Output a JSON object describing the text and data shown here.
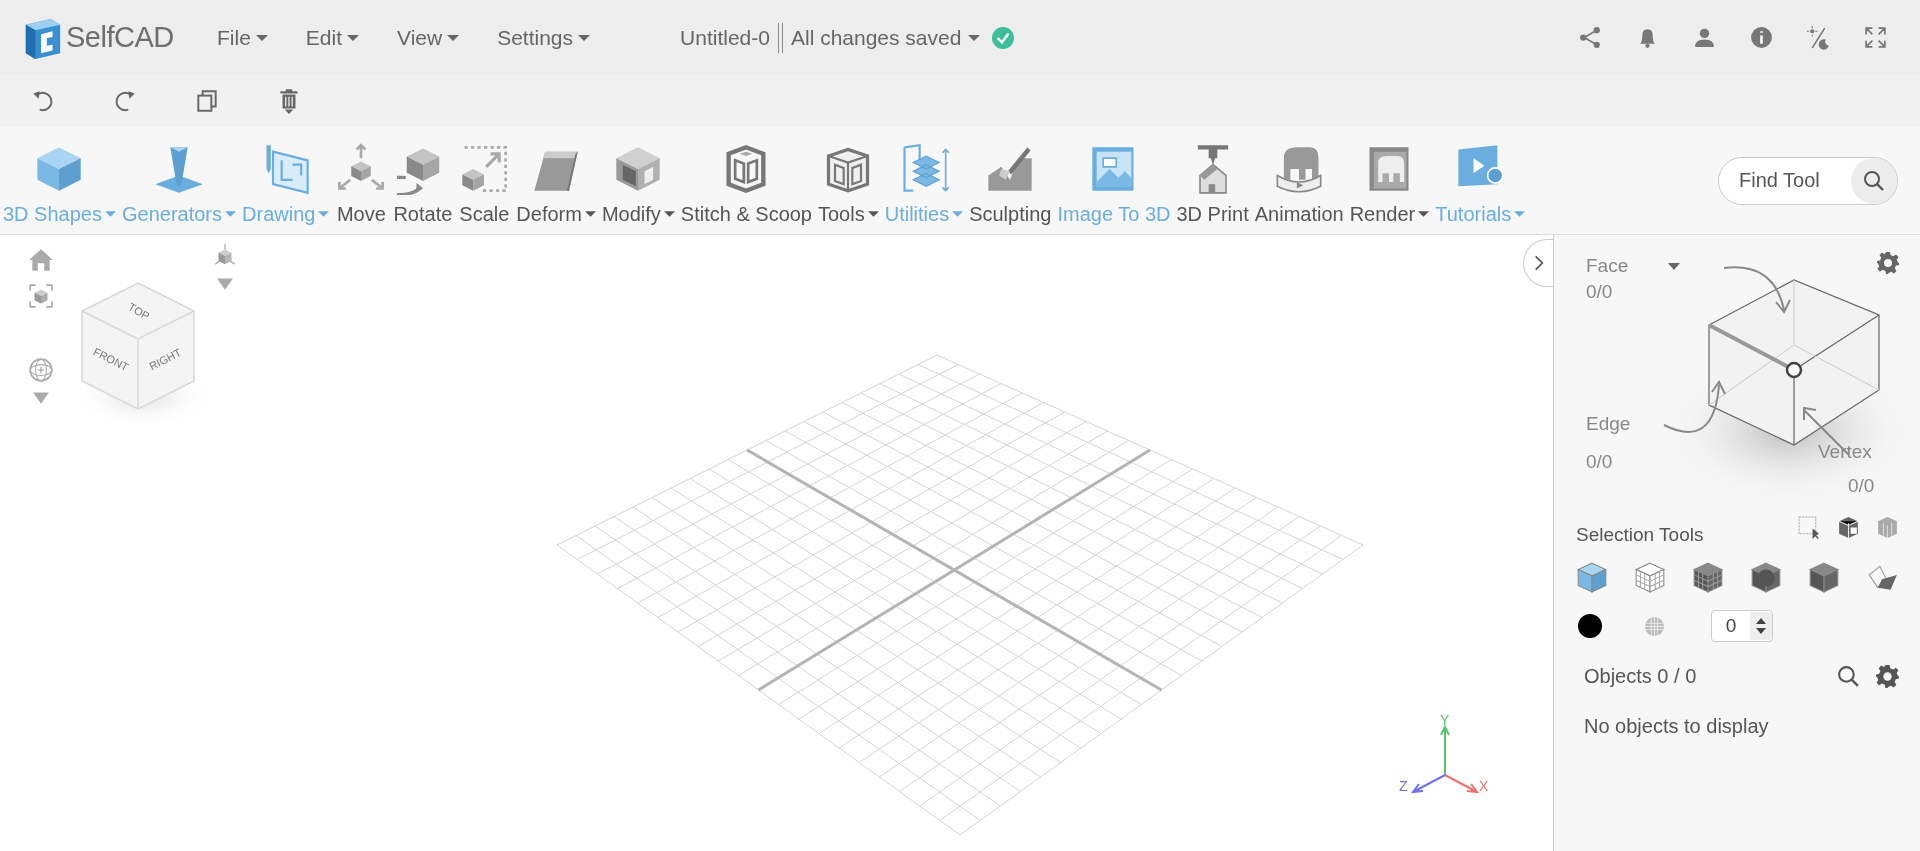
{
  "app": {
    "logo_text": "SelfCAD"
  },
  "menu": [
    {
      "label": "File"
    },
    {
      "label": "Edit"
    },
    {
      "label": "View"
    },
    {
      "label": "Settings"
    }
  ],
  "document": {
    "title": "Untitled-0",
    "status": "All changes saved",
    "saved": true
  },
  "tools": [
    {
      "label": "3D Shapes",
      "color": "#6aaee0",
      "has_menu": true
    },
    {
      "label": "Generators",
      "color": "#6aaee0",
      "has_menu": true
    },
    {
      "label": "Drawing",
      "color": "#6aaee0",
      "has_menu": true
    },
    {
      "label": "Move",
      "color": "#555555",
      "has_menu": false
    },
    {
      "label": "Rotate",
      "color": "#555555",
      "has_menu": false
    },
    {
      "label": "Scale",
      "color": "#555555",
      "has_menu": false
    },
    {
      "label": "Deform",
      "color": "#555555",
      "has_menu": true
    },
    {
      "label": "Modify",
      "color": "#555555",
      "has_menu": true
    },
    {
      "label": "Stitch & Scoop",
      "color": "#555555",
      "has_menu": false
    },
    {
      "label": "Tools",
      "color": "#555555",
      "has_menu": true
    },
    {
      "label": "Utilities",
      "color": "#6aaee0",
      "has_menu": true
    },
    {
      "label": "Sculpting",
      "color": "#555555",
      "has_menu": false
    },
    {
      "label": "Image To 3D",
      "color": "#6aaee0",
      "has_menu": false
    },
    {
      "label": "3D Print",
      "color": "#555555",
      "has_menu": false
    },
    {
      "label": "Animation",
      "color": "#555555",
      "has_menu": false
    },
    {
      "label": "Render",
      "color": "#555555",
      "has_menu": true
    },
    {
      "label": "Tutorials",
      "color": "#6aaee0",
      "has_menu": true
    }
  ],
  "find_tool": {
    "placeholder": "Find Tool"
  },
  "view_cube": {
    "faces": [
      "TOP",
      "FRONT",
      "RIGHT"
    ]
  },
  "axes": {
    "x": "X",
    "y": "Y",
    "z": "Z"
  },
  "panel": {
    "face": {
      "label": "Face",
      "count": "0/0"
    },
    "edge": {
      "label": "Edge",
      "count": "0/0"
    },
    "vertex": {
      "label": "Vertex",
      "count": "0/0"
    },
    "selection_tools_label": "Selection Tools",
    "selection_modes": [
      {
        "selected": true
      },
      {
        "selected": false
      },
      {
        "selected": false
      },
      {
        "selected": false
      },
      {
        "selected": false
      },
      {
        "selected": false
      }
    ],
    "spinner_value": "0",
    "objects_label": "Objects 0 / 0",
    "empty_message": "No objects to display"
  }
}
